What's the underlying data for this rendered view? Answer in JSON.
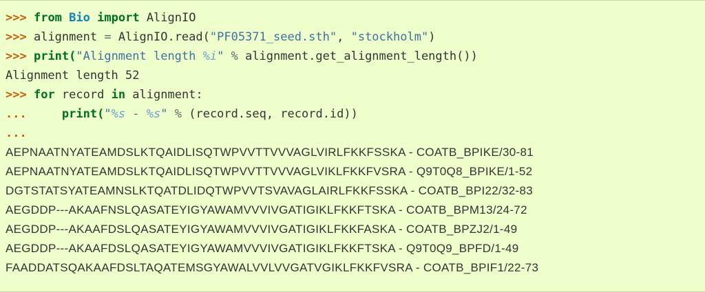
{
  "session": {
    "prompt": ">>>",
    "continuation": "...",
    "line1": {
      "kw_from": "from",
      "module": "Bio",
      "kw_import": "import",
      "name": "AlignIO"
    },
    "line2": {
      "lhs": "alignment ",
      "eq": "=",
      "call": " AlignIO.read(",
      "arg1": "\"PF05371_seed.sth\"",
      "sep": ", ",
      "arg2": "\"stockholm\"",
      "close": ")"
    },
    "line3": {
      "func": "print(",
      "str_a": "\"Alignment length ",
      "fmt": "%i",
      "str_b": "\"",
      "mod": " % ",
      "rest": "alignment.get_alignment_length())"
    },
    "line4": "Alignment length 52",
    "line5": {
      "kw_for": "for",
      "var": " record ",
      "kw_in": "in",
      "rest": " alignment:"
    },
    "line6": {
      "indent": "     ",
      "func": "print(",
      "q1": "\"",
      "fmt1": "%s",
      "mid": " - ",
      "fmt2": "%s",
      "q2": "\"",
      "mod": " % ",
      "rest": "(record.seq, record.id))"
    },
    "records": [
      "AEPNAATNYATEAMDSLKTQAIDLISQTWPVVTTVVVAGLVIRLFKKFSSKA - COATB_BPIKE/30-81",
      "AEPNAATNYATEAMDSLKTQAIDLISQTWPVVTTVVVAGLVIKLFKKFVSRA - Q9T0Q8_BPIKE/1-52",
      "DGTSTATSYATEAMNSLKTQATDLIDQTWPVVTSVAVAGLAIRLFKKFSSKA - COATB_BPI22/32-83",
      "AEGDDP---AKAAFNSLQASATEYIGYAWAMVVVIVGATIGIKLFKKFTSKA - COATB_BPM13/24-72",
      "AEGDDP---AKAAFDSLQASATEYIGYAWAMVVVIVGATIGIKLFKKFASKA - COATB_BPZJ2/1-49",
      "AEGDDP---AKAAFDSLQASATEYIGYAWAMVVVIVGATIGIKLFKKFTSKA - Q9T0Q9_BPFD/1-49",
      "FAADDATSQAKAAFDSLTAQATEMSGYAWALVVLVVGATVGIKLFKKFVSRA - COATB_BPIF1/22-73"
    ]
  }
}
